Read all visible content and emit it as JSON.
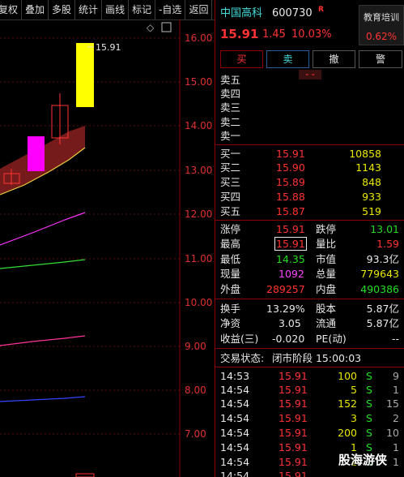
{
  "toolbar": {
    "items": [
      "复权",
      "叠加",
      "多股",
      "统计",
      "画线",
      "标记",
      "-自选",
      "返回"
    ]
  },
  "chart": {
    "price_labels": [
      "16.00",
      "15.00",
      "14.00",
      "13.00",
      "12.00",
      "11.00",
      "10.00",
      "9.00",
      "8.00",
      "7.00"
    ],
    "high_label": "15.91",
    "toggle_icon": "diamond-icon",
    "panel_icon": "square-icon"
  },
  "stock": {
    "name": "中国高科",
    "code": "600730",
    "tag": "R",
    "price": "15.91",
    "change": "1.45",
    "change_pct": "10.03%",
    "ad_title": "教育培训",
    "ad_pct": "0.62%"
  },
  "trade_buttons": {
    "buy": "买",
    "sell": "卖",
    "cancel": "撤",
    "alert": "警"
  },
  "expand_icon": "double-chevron-down-icon",
  "asks": [
    {
      "label": "卖五",
      "price": "",
      "vol": ""
    },
    {
      "label": "卖四",
      "price": "",
      "vol": ""
    },
    {
      "label": "卖三",
      "price": "",
      "vol": ""
    },
    {
      "label": "卖二",
      "price": "",
      "vol": ""
    },
    {
      "label": "卖一",
      "price": "",
      "vol": ""
    }
  ],
  "bids": [
    {
      "label": "买一",
      "price": "15.91",
      "vol": "10858"
    },
    {
      "label": "买二",
      "price": "15.90",
      "vol": "1143"
    },
    {
      "label": "买三",
      "price": "15.89",
      "vol": "848"
    },
    {
      "label": "买四",
      "price": "15.88",
      "vol": "933"
    },
    {
      "label": "买五",
      "price": "15.87",
      "vol": "519"
    }
  ],
  "stats": {
    "limit_up_label": "涨停",
    "limit_up": "15.91",
    "limit_down_label": "跌停",
    "limit_down": "13.01",
    "high_label": "最高",
    "high": "15.91",
    "vol_ratio_label": "量比",
    "vol_ratio": "1.59",
    "low_label": "最低",
    "low": "14.35",
    "mkt_cap_label": "市值",
    "mkt_cap": "93.3亿",
    "last_vol_label": "现量",
    "last_vol": "1092",
    "total_vol_label": "总量",
    "total_vol": "779643",
    "outer_label": "外盘",
    "outer": "289257",
    "inner_label": "内盘",
    "inner": "490386"
  },
  "fundamentals": {
    "turnover_label": "换手",
    "turnover": "13.29%",
    "capital_label": "股本",
    "capital": "5.87亿",
    "nav_label": "净资",
    "nav": "3.05",
    "float_label": "流通",
    "float": "5.87亿",
    "eps_label": "收益(三)",
    "eps": "-0.020",
    "pe_label": "PE(动)",
    "pe": "--"
  },
  "status": {
    "label": "交易状态:",
    "value": "闭市阶段 15:00:03"
  },
  "ticks": [
    {
      "time": "14:53",
      "price": "15.91",
      "vol": "100",
      "side": "S",
      "count": "9"
    },
    {
      "time": "14:54",
      "price": "15.91",
      "vol": "5",
      "side": "S",
      "count": "1"
    },
    {
      "time": "14:54",
      "price": "15.91",
      "vol": "152",
      "side": "S",
      "count": "15"
    },
    {
      "time": "14:54",
      "price": "15.91",
      "vol": "3",
      "side": "S",
      "count": "2"
    },
    {
      "time": "14:54",
      "price": "15.91",
      "vol": "200",
      "side": "S",
      "count": "10"
    },
    {
      "time": "14:54",
      "price": "15.91",
      "vol": "1",
      "side": "S",
      "count": "1"
    },
    {
      "time": "14:54",
      "price": "15.91",
      "vol": "1",
      "side": "S",
      "count": "1"
    },
    {
      "time": "14:54",
      "price": "15.91",
      "vol": "",
      "side": "",
      "count": ""
    }
  ],
  "watermark": "股海游侠",
  "colors": {
    "up": "#ff3333",
    "down": "#22dd22",
    "volume": "#e8e800",
    "accent": "#8b0000"
  }
}
